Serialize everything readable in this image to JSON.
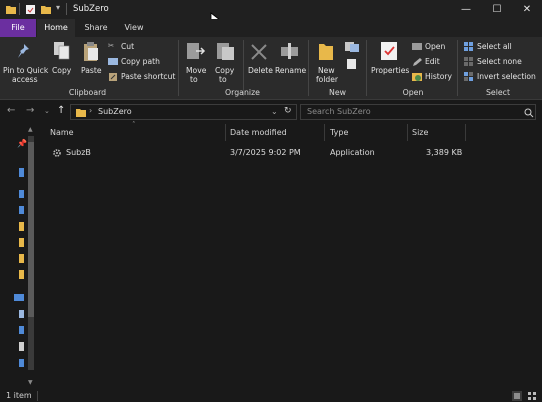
{
  "window": {
    "title": "SubZero",
    "minimize": "—",
    "maximize": "☐",
    "close": "✕"
  },
  "tabs": [
    "File",
    "Home",
    "Share",
    "View"
  ],
  "ribbon": {
    "clipboard": {
      "pin": "Pin to Quick",
      "pin2": "access",
      "copy": "Copy",
      "paste": "Paste",
      "cut": "Cut",
      "copy_path": "Copy path",
      "paste_shortcut": "Paste shortcut",
      "group": "Clipboard"
    },
    "organize": {
      "move": "Move",
      "move2": "to",
      "copy": "Copy",
      "copy2": "to",
      "delete": "Delete",
      "rename": "Rename",
      "group": "Organize"
    },
    "new": {
      "folder": "New",
      "folder2": "folder",
      "group": "New"
    },
    "open": {
      "properties": "Properties",
      "open": "Open",
      "edit": "Edit",
      "history": "History",
      "group": "Open"
    },
    "select": {
      "all": "Select all",
      "none": "Select none",
      "invert": "Invert selection",
      "group": "Select"
    }
  },
  "address": {
    "crumb": "SubZero",
    "search_placeholder": "Search SubZero"
  },
  "columns": {
    "name": "Name",
    "date": "Date modified",
    "type": "Type",
    "size": "Size"
  },
  "files": [
    {
      "name": "SubzB",
      "date": "3/7/2025 9:02 PM",
      "type": "Application",
      "size": "3,389 KB"
    }
  ],
  "status": {
    "count": "1 item"
  }
}
